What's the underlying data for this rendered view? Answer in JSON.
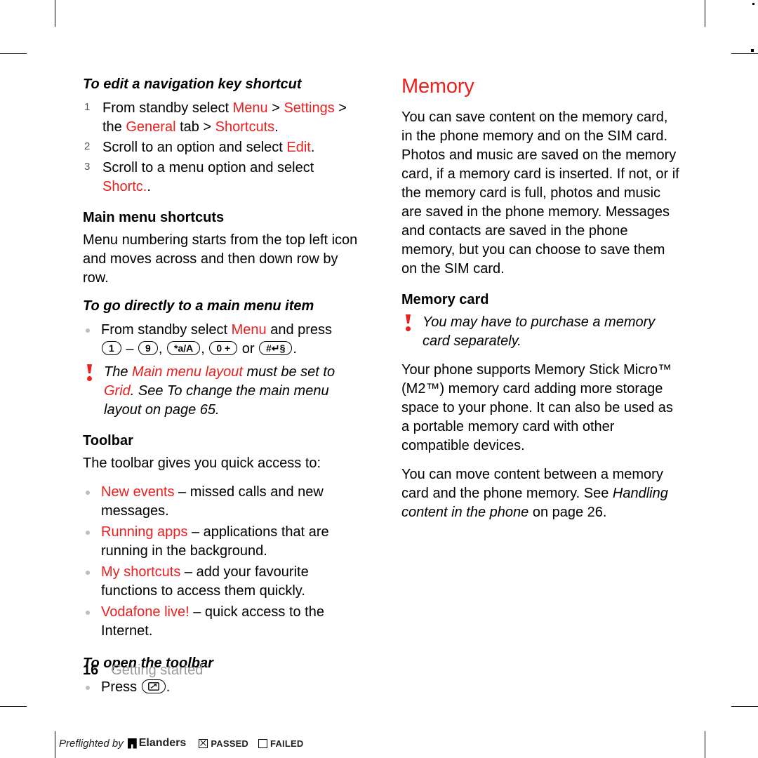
{
  "document": {
    "folio": {
      "page_number": "16",
      "chapter": "Getting started"
    },
    "preflight": {
      "label": "Preflighted by",
      "brand": "Elanders",
      "passed": "PASSED",
      "failed": "FAILED"
    }
  },
  "left_column": {
    "task1": {
      "heading": "To edit a navigation key shortcut",
      "steps": [
        {
          "parts": [
            {
              "t": "From standby select ",
              "c": "black"
            },
            {
              "t": "Menu",
              "c": "red"
            },
            {
              "t": " > ",
              "c": "black"
            },
            {
              "t": "Settings",
              "c": "red"
            },
            {
              "t": " > the ",
              "c": "black"
            },
            {
              "t": "General",
              "c": "red"
            },
            {
              "t": " tab > ",
              "c": "black"
            },
            {
              "t": "Shortcuts",
              "c": "red"
            },
            {
              "t": ".",
              "c": "black"
            }
          ]
        },
        {
          "parts": [
            {
              "t": "Scroll to an option and select ",
              "c": "black"
            },
            {
              "t": "Edit",
              "c": "red"
            },
            {
              "t": ".",
              "c": "black"
            }
          ]
        },
        {
          "parts": [
            {
              "t": "Scroll to a menu option and select ",
              "c": "black"
            },
            {
              "t": "Shortc.",
              "c": "red"
            },
            {
              "t": ".",
              "c": "black"
            }
          ]
        }
      ]
    },
    "main_menu_shortcuts": {
      "heading": "Main menu shortcuts",
      "body": "Menu numbering starts from the top left icon and moves across and then down row by row."
    },
    "task2": {
      "heading": "To go directly to a main menu item",
      "bullet_pre": "From standby select ",
      "bullet_menu": "Menu",
      "bullet_post": " and press ",
      "keys": [
        "1",
        "9",
        "*a/A",
        "0 +",
        "#↵§"
      ],
      "keys_sep1": " – ",
      "keys_sep2": ", ",
      "keys_or": " or ",
      "keys_end": "."
    },
    "note1": {
      "parts": [
        {
          "t": "The ",
          "c": "black"
        },
        {
          "t": "Main menu layout",
          "c": "red"
        },
        {
          "t": " must be set to ",
          "c": "black"
        },
        {
          "t": "Grid",
          "c": "red"
        },
        {
          "t": ". See To change the main menu layout on page 65.",
          "c": "black"
        }
      ]
    },
    "toolbar": {
      "heading": "Toolbar",
      "intro": "The toolbar gives you quick access to:",
      "items": [
        {
          "label": "New events",
          "text": " – missed calls and new messages."
        },
        {
          "label": "Running apps",
          "text": " – applications that are running in the background."
        },
        {
          "label": "My shortcuts",
          "text": " – add your favourite functions to access them quickly."
        },
        {
          "label": "Vodafone live!",
          "text": " – quick access to the Internet."
        }
      ]
    },
    "task3": {
      "heading": "To open the toolbar",
      "bullet": "Press",
      "key": "toolbar-key",
      "end": "."
    }
  },
  "right_column": {
    "heading": "Memory",
    "intro": "You can save content on the memory card, in the phone memory and on the SIM card. Photos and music are saved on the memory card, if a memory card is inserted. If not, or if the memory card is full, photos and music are saved in the phone memory. Messages and contacts are saved in the phone memory, but you can choose to save them on the SIM card.",
    "memory_card": {
      "heading": "Memory card",
      "note": "You may have to purchase a memory card separately.",
      "para1": "Your phone supports Memory Stick Micro™ (M2™) memory card adding more storage space to your phone. It can also be used as a portable memory card with other compatible devices.",
      "para2_pre": "You can move content between a memory card and the phone memory. See ",
      "para2_italic": "Handling content in the phone",
      "para2_post": " on page 26."
    }
  },
  "colors": {
    "accent_red": "#e8201e",
    "muted_gray": "#9a9a9a",
    "bullet_gray": "#bdbdbd"
  }
}
